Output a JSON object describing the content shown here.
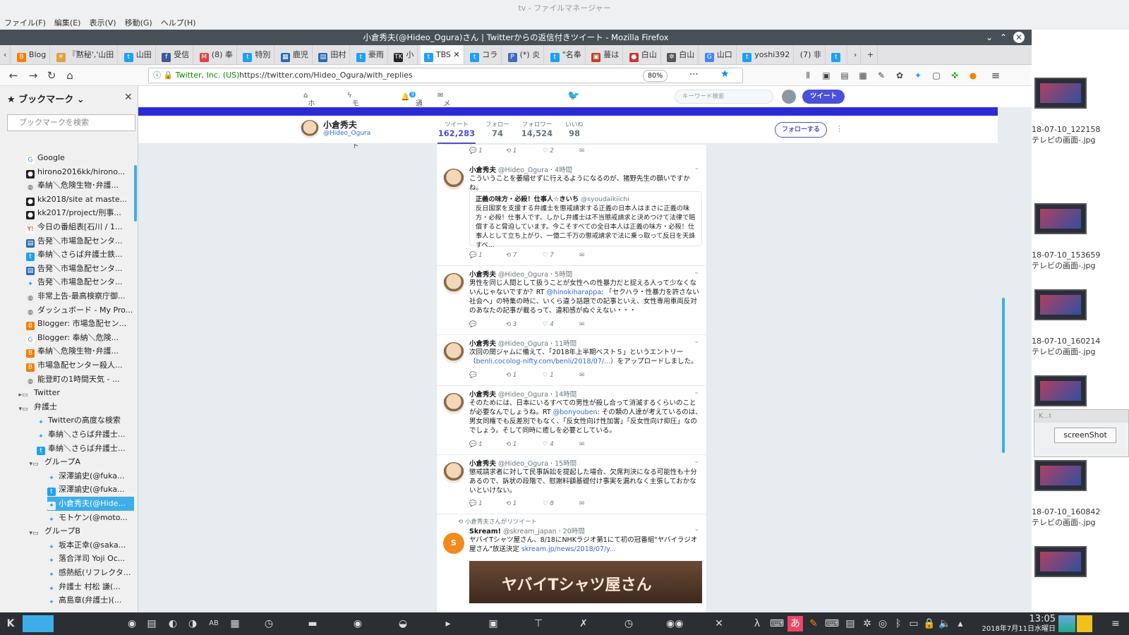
{
  "file_manager": {
    "title": "tv - ファイルマネージャー",
    "menus": [
      "ファイル(F)",
      "編集(E)",
      "表示(V)",
      "移動(G)",
      "ヘルプ(H)"
    ],
    "files": [
      "18-07-10_122158",
      "テレビの画面-.jpg",
      "18-07-10_153659",
      "テレビの画面-.jpg",
      "18-07-10_160214",
      "テレビの画面-.jpg",
      "18-07-10_160842",
      "テレビの画面-.jpg"
    ]
  },
  "screenshot_app": {
    "title": "K...t",
    "button": "screenShot"
  },
  "browser": {
    "title": "小倉秀夫(@Hideo_Ogura)さん | Twitterからの返信付きツイート - Mozilla Firefox",
    "tabs": [
      "Blog",
      "『黙秘','山田",
      "山田",
      "受信",
      "(8) 奉",
      "特別",
      "鹿児",
      "田村",
      "豪雨",
      "小",
      "TBS",
      "コラ",
      "(*) 炎",
      "\"名奉",
      "蔓は",
      "白山",
      "白山",
      "山口",
      "yoshi392",
      "(7) 非"
    ],
    "security": "Twitter, Inc. (US)",
    "url": "https://twitter.com/Hideo_Ogura/with_replies",
    "zoom": "80%"
  },
  "sidebar": {
    "title": "ブックマーク",
    "search_placeholder": "ブックマークを検索",
    "items": [
      "Google",
      "hirono2016kk/hirono...",
      "奉納＼危険生物･弁護...",
      "kk2018/site at maste...",
      "kk2017/project/刑事...",
      "今日の番組表[石川 / 1...",
      "告発＼市場急配センタ...",
      "奉納＼さらば弁護士鉄...",
      "告発＼市場急配センタ...",
      "告発＼市場急配センタ...",
      "非常上告-最高検察庁御...",
      "ダッシュボード - My Pro...",
      "Blogger: 市場急配セン...",
      "Blogger: 奉納＼危険...",
      "奉納＼危険生物･弁護...",
      "市場急配センター殺人...",
      "能登町の1時間天気 - ...",
      "Twitter",
      "弁護士",
      "Twitterの高度な検索",
      "奉納＼さらば弁護士...",
      "奉納＼さらば弁護士...",
      "グループA",
      "深澤諭史(@fuka...",
      "深澤諭史(@fuka...",
      "小倉秀夫(@Hide...",
      "モトケン(@moto...",
      "グループB",
      "坂本正幸(@saka...",
      "落合洋司 Yoji Oc...",
      "感熱紙(リフレクタ...",
      "弁護士 村松 謙(...",
      "高島章(弁護士)(..."
    ]
  },
  "twitter": {
    "nav": [
      "ホーム",
      "モーメント",
      "通知",
      "メッセージ"
    ],
    "notif_count": "9",
    "search_placeholder": "キーワード検索",
    "tweet_button": "ツイート",
    "profile": {
      "name": "小倉秀夫",
      "handle": "@Hideo_Ogura",
      "follow_button": "フォローする",
      "stats": [
        {
          "label": "ツイート",
          "value": "162,283"
        },
        {
          "label": "フォロー",
          "value": "74"
        },
        {
          "label": "フォロワー",
          "value": "14,524"
        },
        {
          "label": "いいね",
          "value": "98"
        }
      ]
    },
    "top_actions": {
      "reply": "1",
      "retweet": "1",
      "like": "2"
    },
    "tweets": [
      {
        "name": "小倉秀夫",
        "handle": "@Hideo_Ogura",
        "time": "4時間",
        "text": "こういうことを萎縮せずに行えるようになるのが、猪野先生の願いですかね。",
        "quote": {
          "name": "正義の味方・必殺！仕事人☆きいち",
          "handle": "@syoudaikiichi",
          "text": "反日国家を支援する弁護士を懲戒請求する正義の日本人はまさに正義の味方・必殺！仕事人です。しかし弁護士は不当懲戒請求と決めつけて法律で賠償すると脅迫しています。今こそすべての全日本人は正義の味方・必殺！仕事人として立ち上がり、一億二千万の懲戒請求で法に乗っ取って反日を天誅すべ..."
        },
        "reply": "1",
        "retweet": "7",
        "like": "7"
      },
      {
        "name": "小倉秀夫",
        "handle": "@Hideo_Ogura",
        "time": "5時間",
        "text1": "男性を同じ人間として扱うことが女性への性暴力だと捉える人って少なくないんじゃないですか？RT ",
        "mention": "@hinokiharappa",
        "text2": ": 「セクハラ・性暴力を許さない社会へ」の特集の時に、いくら違う話題での記事といえ、女性専用車両反対のあなたの記事が載るって、違和感がぬぐえない・・・",
        "reply": "",
        "retweet": "3",
        "like": "4"
      },
      {
        "name": "小倉秀夫",
        "handle": "@Hideo_Ogura",
        "time": "11時間",
        "text1": "次回の関ジャムに備えて、「2018年上半期ベスト５」というエントリー（",
        "link": "benli.cocolog-nifty.com/benli/2018/07/...",
        "text2": "）をアップロードしました。",
        "reply": "",
        "retweet": "1",
        "like": "1"
      },
      {
        "name": "小倉秀夫",
        "handle": "@Hideo_Ogura",
        "time": "14時間",
        "text1": "そのためには、日本にいるすべての男性が殺し合って消滅するくらいのことが必要なんでしょうね。RT ",
        "mention": "@bonyouben",
        "text2": ": その類の人達が考えているのは、男女同権でも反差別でもなく、「反女性向け性加害」「反女性向け抑圧」なのでしょう。そして同時に癒しを必要としている。",
        "reply": "1",
        "retweet": "1",
        "like": "4"
      },
      {
        "name": "小倉秀夫",
        "handle": "@Hideo_Ogura",
        "time": "15時間",
        "text": "懲戒請求者に対して民事訴訟を提起した場合、欠席判決になる可能性も十分あるので、訴状の段階で、慰謝料額基礎付け事実を漏れなく主張しておかないといけない。",
        "reply": "1",
        "retweet": "1",
        "like": "8"
      },
      {
        "rt_note": "小倉秀夫さんがリツイート",
        "name": "Skream!",
        "handle": "@skream_japan",
        "time": "20時間",
        "text": "ヤバイTシャツ屋さん、8/18にNHKラジオ第1にて初の冠番組\"ヤバイラジオ屋さん\"放送決定 ",
        "link": "skream.jp/news/2018/07/y...",
        "image_text": "ヤバイTシャツ屋さん"
      }
    ]
  },
  "taskbar": {
    "time": "13:05",
    "date": "2018年7月11日水曜日"
  }
}
